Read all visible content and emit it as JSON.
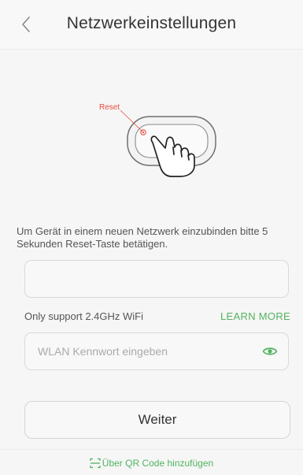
{
  "header": {
    "title": "Netzwerkeinstellungen",
    "back_icon": "chevron-left-icon"
  },
  "illustration": {
    "reset_label": "Reset",
    "reset_label_color": "#e84b3c",
    "icon": "hand-pointer-icon"
  },
  "description": "Um Gerät in einem neuen Netzwerk einzubinden bitte 5 Sekunden Reset-Taste betätigen.",
  "ssid_field": {
    "value": "",
    "placeholder": ""
  },
  "support": {
    "text": "Only support 2.4GHz WiFi",
    "learn_more_label": "LEARN MORE"
  },
  "password_field": {
    "value": "",
    "placeholder": "WLAN Kennwort eingeben",
    "visibility_icon": "eye-icon"
  },
  "next_button_label": "Weiter",
  "footer": {
    "qr_label": "Über QR Code hinzufügen",
    "qr_icon": "qr-scan-icon"
  },
  "colors": {
    "accent": "#52b35f",
    "reset_red": "#e84b3c"
  }
}
